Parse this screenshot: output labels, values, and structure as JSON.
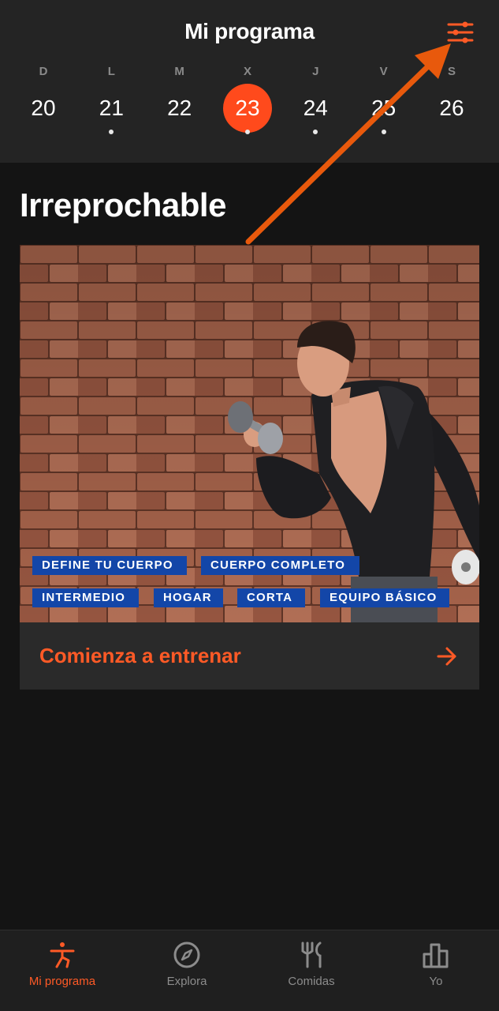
{
  "header": {
    "title": "Mi programa",
    "filter_icon": "sliders-icon",
    "week": [
      {
        "letter": "D",
        "num": "20",
        "dot": false,
        "active": false
      },
      {
        "letter": "L",
        "num": "21",
        "dot": true,
        "active": false
      },
      {
        "letter": "M",
        "num": "22",
        "dot": false,
        "active": false
      },
      {
        "letter": "X",
        "num": "23",
        "dot": true,
        "active": true
      },
      {
        "letter": "J",
        "num": "24",
        "dot": true,
        "active": false
      },
      {
        "letter": "V",
        "num": "25",
        "dot": true,
        "active": false
      },
      {
        "letter": "S",
        "num": "26",
        "dot": false,
        "active": false
      }
    ]
  },
  "program": {
    "title": "Irreprochable",
    "tags": [
      "DEFINE TU CUERPO",
      "CUERPO COMPLETO",
      "INTERMEDIO",
      "HOGAR",
      "CORTA",
      "EQUIPO BÁSICO"
    ],
    "cta_label": "Comienza a entrenar",
    "cta_icon": "arrow-right-icon"
  },
  "nav": {
    "items": [
      {
        "label": "Mi programa",
        "icon": "stretching-person-icon",
        "active": true
      },
      {
        "label": "Explora",
        "icon": "compass-icon",
        "active": false
      },
      {
        "label": "Comidas",
        "icon": "fork-knife-icon",
        "active": false
      },
      {
        "label": "Yo",
        "icon": "bar-chart-icon",
        "active": false
      }
    ]
  },
  "colors": {
    "accent": "#ff4a1c",
    "tag_bg": "#1346a8",
    "annotation_arrow": "#e8590c"
  }
}
